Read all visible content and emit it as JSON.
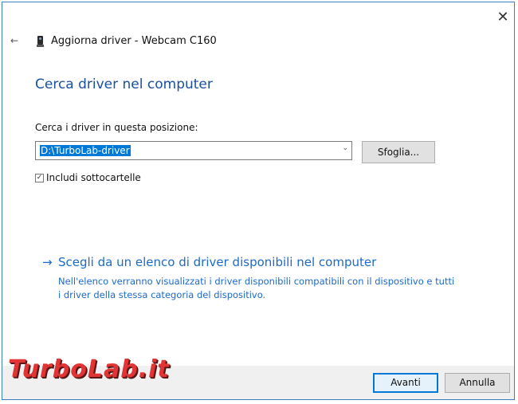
{
  "window": {
    "title": "Aggiorna driver - Webcam C160",
    "close_glyph": "✕",
    "back_glyph": "←"
  },
  "page": {
    "heading": "Cerca driver nel computer",
    "search_label": "Cerca i driver in questa posizione:",
    "path_value": "D:\\TurboLab-driver",
    "combo_arrow": "⌄",
    "browse_label": "Sfoglia...",
    "subfolders_checked": true,
    "subfolders_label": "Includi sottocartelle",
    "checkbox_glyph": "✓",
    "link_arrow": "→",
    "link_text": "Scegli da un elenco di driver disponibili nel computer",
    "link_description": "Nell'elenco verranno visualizzati i driver disponibili compatibili con il dispositivo e tutti i driver della stessa categoria del dispositivo."
  },
  "footer": {
    "next_label": "Avanti",
    "cancel_label": "Annulla"
  },
  "watermark": {
    "text": "TurboLab.it"
  },
  "colors": {
    "accent": "#0078d7",
    "heading": "#1b4fa0",
    "link": "#1b6ac9",
    "watermark": "#e02020"
  },
  "icons": {
    "close": "close-icon",
    "back": "back-arrow-icon",
    "device": "webcam-device-icon",
    "dropdown": "chevron-down-icon",
    "link_arrow": "arrow-right-icon"
  }
}
